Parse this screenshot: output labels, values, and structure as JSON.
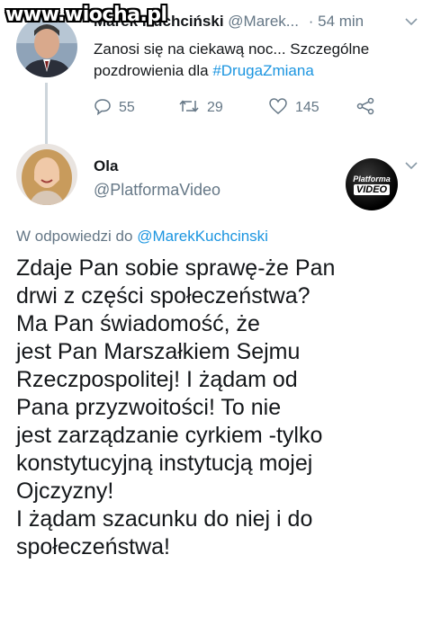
{
  "watermark": "www.wiocha.pl",
  "tweet1": {
    "name": "Marek Kuchciński",
    "handle": "@Marek...",
    "separator": "·",
    "time": "54 min",
    "text": "Zanosi się na ciekawą noc... Szczególne pozdrowienia dla",
    "hashtag": "#DrugaZmiana",
    "replies": "55",
    "retweets": "29",
    "likes": "145"
  },
  "tweet2": {
    "name": "Ola",
    "handle": "@PlatformaVideo",
    "badge_line1": "Platforma",
    "badge_line2": "VIDEO",
    "reply_prefix": "W odpowiedzi do",
    "reply_mention": "@MarekKuchcinski",
    "body_lines": [
      "Zdaje Pan sobie sprawę-że Pan",
      "drwi z części społeczeństwa?",
      "Ma Pan świadomość, że",
      "jest Pan Marszałkiem Sejmu",
      "Rzeczpospolitej! I żądam od",
      "Pana przyzwoitości! To nie",
      "jest zarządzanie cyrkiem -tylko",
      "konstytucyjną instytucją mojej",
      "Ojczyzny!",
      "I żądam szacunku do niej i do",
      "społeczeństwa!"
    ]
  },
  "colors": {
    "link": "#1b95e0",
    "muted": "#657786",
    "text": "#14171a"
  },
  "icons": [
    "reply-icon",
    "retweet-icon",
    "like-icon",
    "share-icon",
    "chevron-down-icon"
  ]
}
